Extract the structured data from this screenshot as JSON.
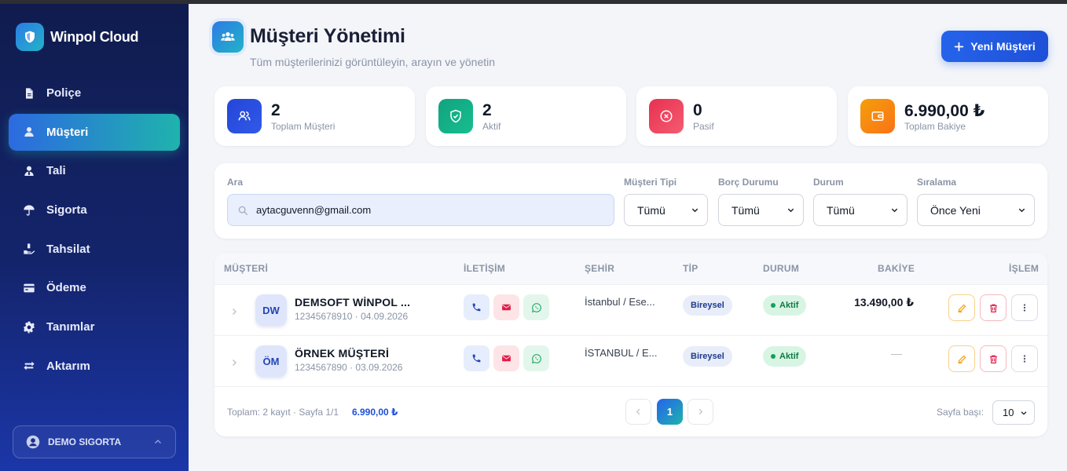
{
  "brand": {
    "name": "Winpol Cloud"
  },
  "sidebar": {
    "items": [
      {
        "label": "Poliçe",
        "icon": "document-icon",
        "active": false
      },
      {
        "label": "Müşteri",
        "icon": "user-icon",
        "active": true
      },
      {
        "label": "Tali",
        "icon": "user-tie-icon",
        "active": false
      },
      {
        "label": "Sigorta",
        "icon": "umbrella-icon",
        "active": false
      },
      {
        "label": "Tahsilat",
        "icon": "hand-coin-icon",
        "active": false
      },
      {
        "label": "Ödeme",
        "icon": "credit-card-icon",
        "active": false
      },
      {
        "label": "Tanımlar",
        "icon": "gear-icon",
        "active": false
      },
      {
        "label": "Aktarım",
        "icon": "transfer-icon",
        "active": false
      }
    ],
    "user": {
      "label": "DEMO SIGORTA"
    }
  },
  "header": {
    "title": "Müşteri Yönetimi",
    "subtitle": "Tüm müşterilerinizi görüntüleyin, arayın ve yönetin",
    "new_button": "Yeni Müşteri"
  },
  "stats": [
    {
      "value": "2",
      "label": "Toplam Müşteri",
      "color": "#2446d8"
    },
    {
      "value": "2",
      "label": "Aktif",
      "color": "#13a97f"
    },
    {
      "value": "0",
      "label": "Pasif",
      "color": "#ef3f5a"
    },
    {
      "value": "6.990,00 ₺",
      "label": "Toplam Bakiye",
      "color": "#f59e0b"
    }
  ],
  "filters": {
    "search_label": "Ara",
    "search_value": "aytacguvenn@gmail.com",
    "type_label": "Müşteri Tipi",
    "type_value": "Tümü",
    "debt_label": "Borç Durumu",
    "debt_value": "Tümü",
    "status_label": "Durum",
    "status_value": "Tümü",
    "sort_label": "Sıralama",
    "sort_value": "Önce Yeni"
  },
  "table": {
    "headers": {
      "customer": "MÜŞTERİ",
      "contact": "İLETİŞİM",
      "city": "ŞEHİR",
      "type": "TİP",
      "status": "DURUM",
      "balance": "BAKİYE",
      "action": "İŞLEM"
    },
    "rows": [
      {
        "initials": "DW",
        "name": "DEMSOFT WİNPOL ...",
        "meta": "12345678910 · 04.09.2026",
        "city": "İstanbul / Ese...",
        "type": "Bireysel",
        "status": "Aktif",
        "balance": "13.490,00 ₺"
      },
      {
        "initials": "ÖM",
        "name": "ÖRNEK MÜŞTERİ",
        "meta": "1234567890 · 03.09.2026",
        "city": "İSTANBUL / E...",
        "type": "Bireysel",
        "status": "Aktif",
        "balance": "—"
      }
    ]
  },
  "footer": {
    "summary": "Toplam: 2 kayıt · Sayfa 1/1",
    "total": "6.990,00 ₺",
    "current_page": "1",
    "page_size_label": "Sayfa başı:",
    "page_size": "10"
  }
}
